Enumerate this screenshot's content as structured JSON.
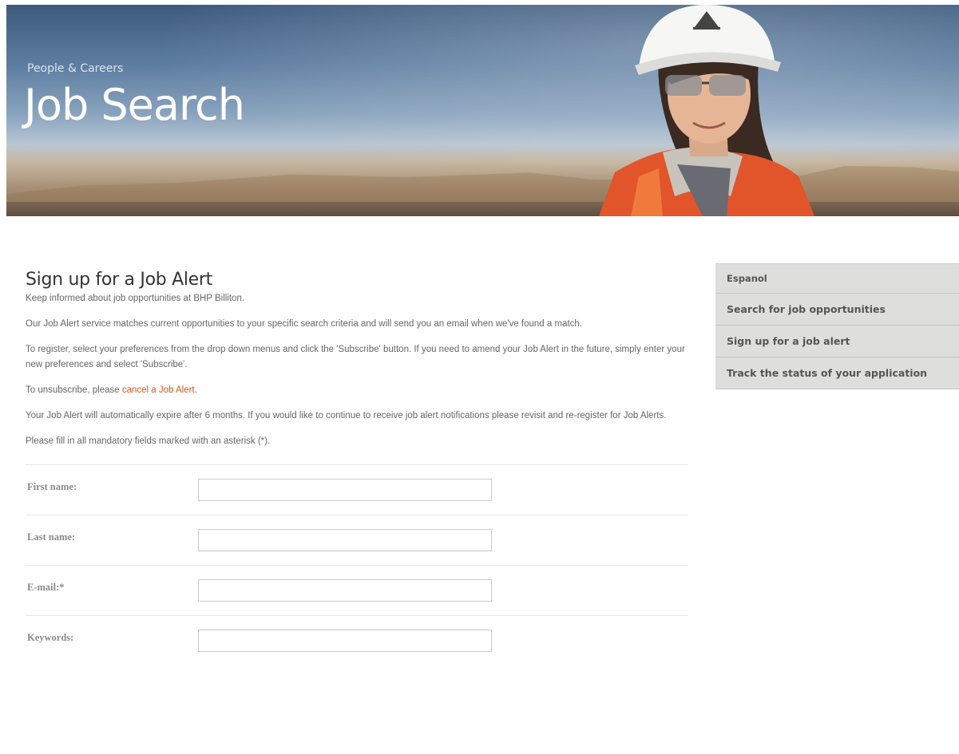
{
  "banner": {
    "subtitle": "People & Careers",
    "title": "Job Search"
  },
  "main": {
    "title": "Sign up for a Job Alert",
    "intro": "Keep informed about job opportunities at BHP Billiton.",
    "paragraph_match": "Our Job Alert service matches current opportunities to your specific search criteria and will send you an email when we've found a match.",
    "paragraph_register": "To register, select your preferences from the drop down menus and click the 'Subscribe' button. If you need to amend your Job Alert in the future, simply enter your new preferences and select 'Subscribe'.",
    "unsubscribe_prefix": "To unsubscribe, please ",
    "unsubscribe_link": "cancel a Job Alert",
    "unsubscribe_suffix": ".",
    "paragraph_expire": "Your Job Alert will automatically expire after 6 months. If you would like to continue to receive job alert notifications please revisit and re-register for Job Alerts.",
    "paragraph_mandatory": "Please fill in all mandatory fields marked with an asterisk (*)."
  },
  "form": {
    "first_name_label": "First name:",
    "first_name_value": "",
    "last_name_label": "Last name:",
    "last_name_value": "",
    "email_label": "E-mail:*",
    "email_value": "",
    "keywords_label": "Keywords:",
    "keywords_value": ""
  },
  "sidebar": {
    "items": [
      {
        "label": "Espanol"
      },
      {
        "label": "Search for job opportunities"
      },
      {
        "label": "Sign up for a job alert"
      },
      {
        "label": "Track the status of your application"
      }
    ]
  },
  "colors": {
    "link": "#d2561b",
    "sidebar_bg": "#dededc"
  }
}
